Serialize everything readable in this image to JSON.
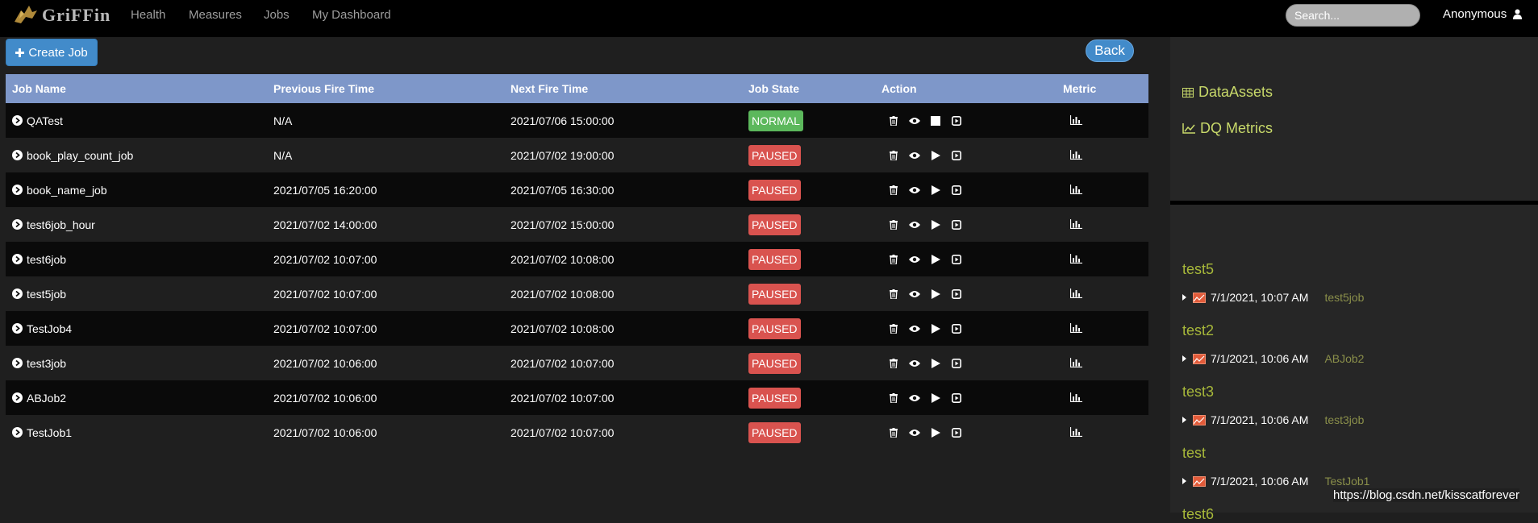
{
  "navbar": {
    "brand": "GriFFin",
    "links": [
      "Health",
      "Measures",
      "Jobs",
      "My Dashboard"
    ],
    "search_placeholder": "Search...",
    "user": "Anonymous"
  },
  "toolbar": {
    "create_label": "Create Job",
    "back_label": "Back"
  },
  "table": {
    "headers": [
      "Job Name",
      "Previous Fire Time",
      "Next Fire Time",
      "Job State",
      "Action",
      "Metric"
    ],
    "rows": [
      {
        "name": "QATest",
        "prev": "N/A",
        "next": "2021/07/06 15:00:00",
        "state": "NORMAL"
      },
      {
        "name": "book_play_count_job",
        "prev": "N/A",
        "next": "2021/07/02 19:00:00",
        "state": "PAUSED"
      },
      {
        "name": "book_name_job",
        "prev": "2021/07/05 16:20:00",
        "next": "2021/07/05 16:30:00",
        "state": "PAUSED"
      },
      {
        "name": "test6job_hour",
        "prev": "2021/07/02 14:00:00",
        "next": "2021/07/02 15:00:00",
        "state": "PAUSED"
      },
      {
        "name": "test6job",
        "prev": "2021/07/02 10:07:00",
        "next": "2021/07/02 10:08:00",
        "state": "PAUSED"
      },
      {
        "name": "test5job",
        "prev": "2021/07/02 10:07:00",
        "next": "2021/07/02 10:08:00",
        "state": "PAUSED"
      },
      {
        "name": "TestJob4",
        "prev": "2021/07/02 10:07:00",
        "next": "2021/07/02 10:08:00",
        "state": "PAUSED"
      },
      {
        "name": "test3job",
        "prev": "2021/07/02 10:06:00",
        "next": "2021/07/02 10:07:00",
        "state": "PAUSED"
      },
      {
        "name": "ABJob2",
        "prev": "2021/07/02 10:06:00",
        "next": "2021/07/02 10:07:00",
        "state": "PAUSED"
      },
      {
        "name": "TestJob1",
        "prev": "2021/07/02 10:06:00",
        "next": "2021/07/02 10:07:00",
        "state": "PAUSED"
      }
    ]
  },
  "sidebar": {
    "links": [
      "DataAssets",
      "DQ Metrics"
    ],
    "metrics": [
      {
        "title": "test5",
        "time": "7/1/2021, 10:07 AM",
        "job": "test5job"
      },
      {
        "title": "test2",
        "time": "7/1/2021, 10:06 AM",
        "job": "ABJob2"
      },
      {
        "title": "test3",
        "time": "7/1/2021, 10:06 AM",
        "job": "test3job"
      },
      {
        "title": "test",
        "time": "7/1/2021, 10:06 AM",
        "job": "TestJob1"
      },
      {
        "title": "test6"
      }
    ]
  },
  "watermark": "https://blog.csdn.net/kisscatforever",
  "colors": {
    "header_bg": "#7e97c9",
    "normal": "#5cb85c",
    "paused": "#d9534f",
    "accent_link": "#c8d96a",
    "metric_title": "#a7b83a"
  },
  "icons": {
    "chevron": "chevron-circle-right-icon",
    "delete": "trash-icon",
    "view": "eye-icon",
    "stop": "stop-icon",
    "play": "play-icon",
    "run": "play-square-icon",
    "metric": "bar-chart-icon"
  }
}
